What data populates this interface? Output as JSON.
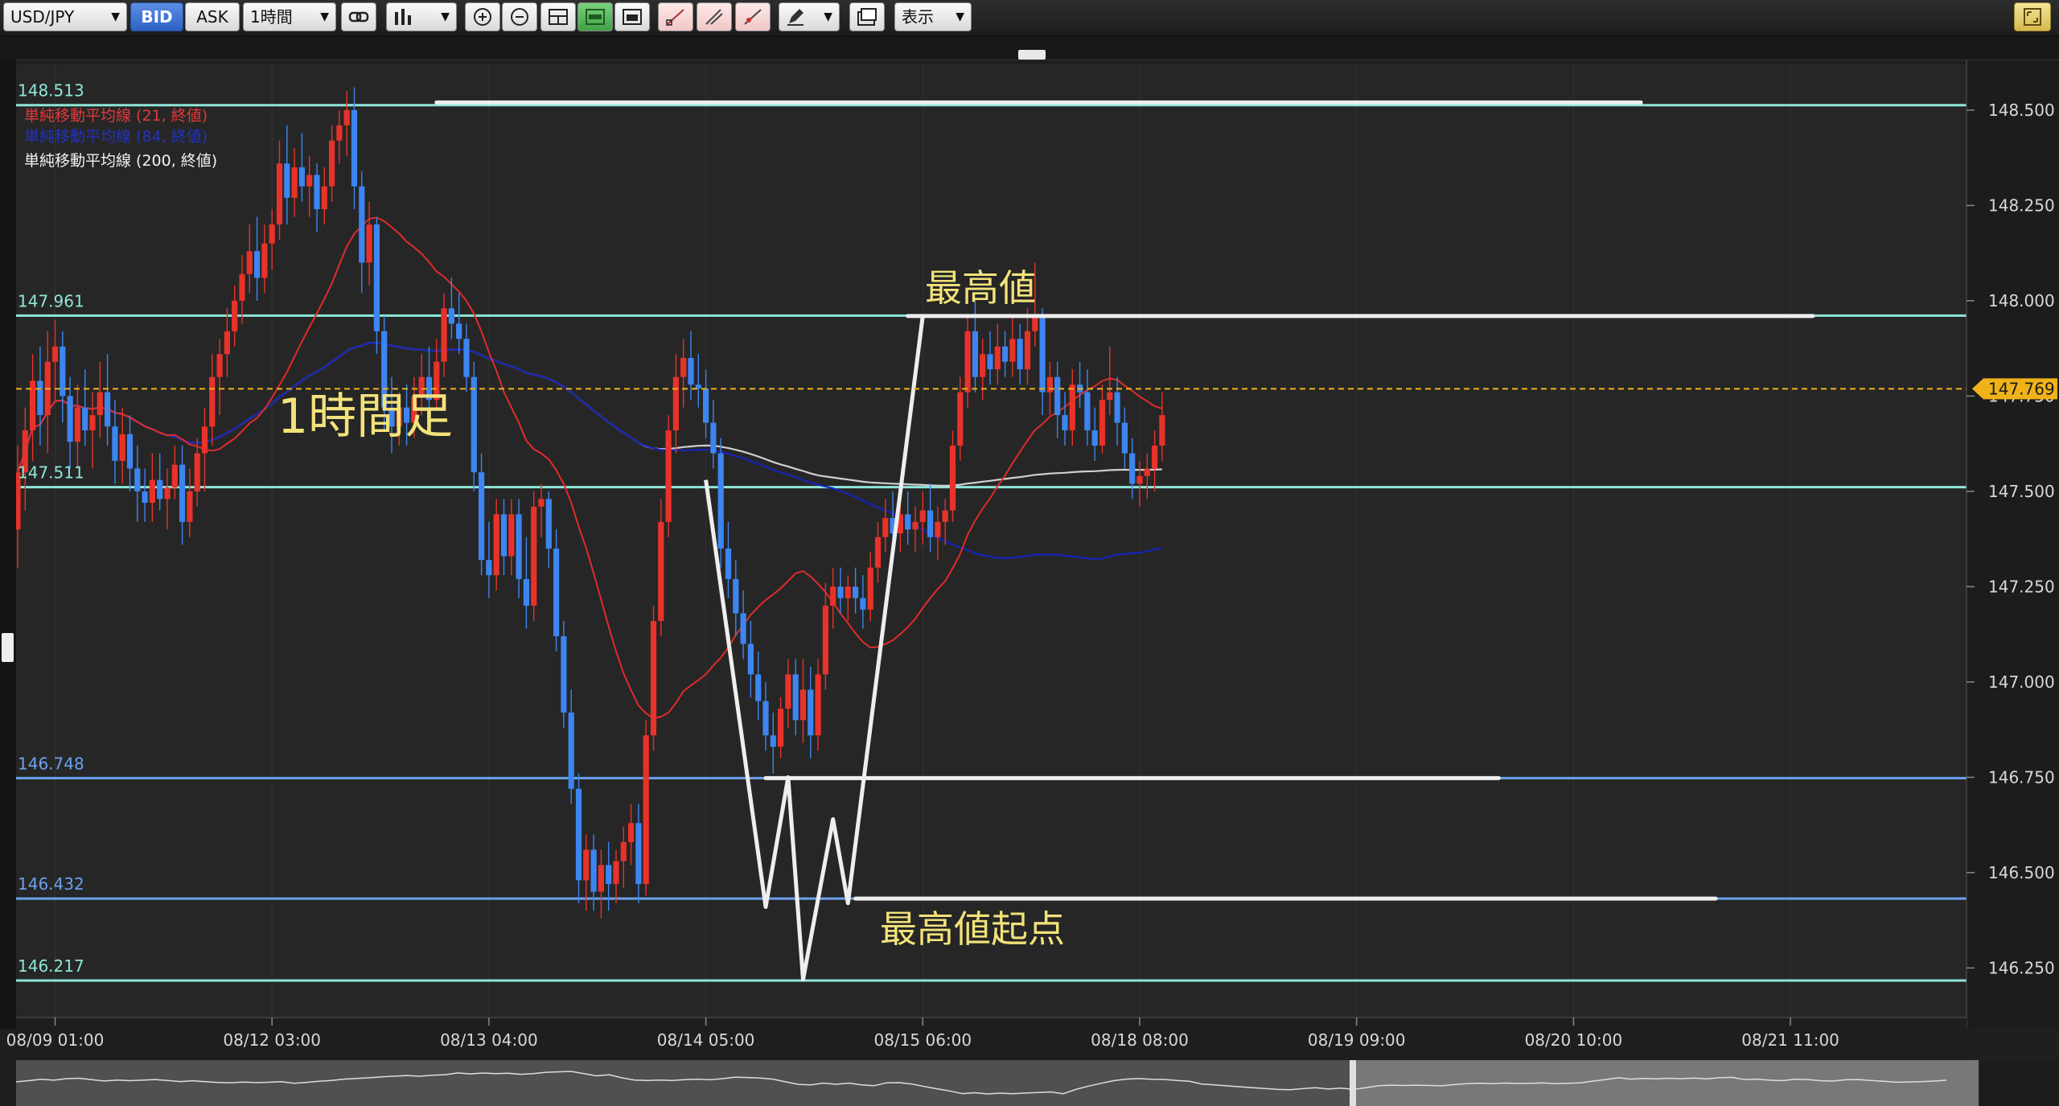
{
  "toolbar": {
    "pair": "USD/JPY",
    "bid": "BID",
    "ask": "ASK",
    "timeframe": "1時間",
    "display": "表示",
    "icons": [
      "chain-link-icon",
      "bar-chart-type-icon",
      "zoom-in-icon",
      "zoom-out-icon",
      "window-tile-icon",
      "toggle-green-icon",
      "window-icon",
      "trendline-icon",
      "channel-icon",
      "fib-icon",
      "pencil-icon",
      "screenshot-icon",
      "maximize-icon"
    ]
  },
  "legend": {
    "sma21": "単純移動平均線 (21, 終値)",
    "sma84": "単純移動平均線 (84, 終値)",
    "sma200": "単純移動平均線 (200, 終値)"
  },
  "annotations": {
    "timeframe_label": "1時間足",
    "high_label": "最高値",
    "high_start_label": "最高値起点"
  },
  "level_labels": [
    "148.513",
    "147.961",
    "147.511",
    "146.748",
    "146.432",
    "146.217"
  ],
  "colors": {
    "background": "#262626",
    "up_candle": "#e8322a",
    "down_candle": "#3d85f0",
    "sma21": "#e02b2b",
    "sma84": "#1622b8",
    "sma200": "#cfcfcf",
    "current_price": "#f0b21a",
    "annotation_text": "#f2e27a",
    "cyan_line": "#8fe6d8",
    "blue_line": "#6aa2ee",
    "drawn_line": "#eeeeee"
  },
  "chart_data": {
    "type": "candlestick",
    "symbol": "USD/JPY",
    "interval": "1時間",
    "price_axis": {
      "ylim": [
        146.12,
        148.62
      ],
      "ticks": [
        "148.500",
        "148.250",
        "148.000",
        "147.750",
        "147.500",
        "147.250",
        "147.000",
        "146.750",
        "146.500",
        "146.250"
      ],
      "current_price": "147.769"
    },
    "time_axis": {
      "ticks": [
        "08/09 01:00",
        "08/12 03:00",
        "08/13 04:00",
        "08/14 05:00",
        "08/15 06:00",
        "08/18 08:00",
        "08/19 09:00",
        "08/20 10:00",
        "08/21 11:00"
      ],
      "tick_bar_index": [
        5,
        34,
        63,
        92,
        121,
        150,
        179,
        208,
        237
      ]
    },
    "horizontal_levels": [
      {
        "label": "148.513",
        "value": 148.513,
        "style": "cyan"
      },
      {
        "label": "147.961",
        "value": 147.961,
        "style": "cyan"
      },
      {
        "label": "147.511",
        "value": 147.511,
        "style": "cyan"
      },
      {
        "label": "146.748",
        "value": 146.748,
        "style": "blue"
      },
      {
        "label": "146.432",
        "value": 146.432,
        "style": "blue"
      },
      {
        "label": "146.217",
        "value": 146.217,
        "style": "cyan"
      }
    ],
    "drawn_horizontal_lines": [
      {
        "price": 148.52,
        "from_bar": 56,
        "to_bar": 217
      },
      {
        "price": 147.96,
        "from_bar": 119,
        "to_bar": 240
      },
      {
        "price": 146.748,
        "from_bar": 100,
        "to_bar": 198
      },
      {
        "price": 146.432,
        "from_bar": 112,
        "to_bar": 227
      }
    ],
    "drawn_zigzag": [
      [
        92,
        147.53
      ],
      [
        100,
        146.41
      ],
      [
        103,
        146.75
      ],
      [
        105,
        146.22
      ],
      [
        109,
        146.64
      ],
      [
        111,
        146.42
      ],
      [
        121,
        147.96
      ]
    ],
    "ohlc": [
      [
        147.4,
        147.62,
        147.3,
        147.55
      ],
      [
        147.55,
        147.72,
        147.45,
        147.66
      ],
      [
        147.66,
        147.86,
        147.58,
        147.79
      ],
      [
        147.79,
        147.88,
        147.62,
        147.7
      ],
      [
        147.7,
        147.92,
        147.6,
        147.84
      ],
      [
        147.84,
        147.95,
        147.74,
        147.88
      ],
      [
        147.88,
        147.92,
        147.68,
        147.75
      ],
      [
        147.75,
        147.8,
        147.56,
        147.63
      ],
      [
        147.63,
        147.78,
        147.56,
        147.72
      ],
      [
        147.72,
        147.82,
        147.62,
        147.66
      ],
      [
        147.66,
        147.76,
        147.56,
        147.7
      ],
      [
        147.7,
        147.84,
        147.64,
        147.76
      ],
      [
        147.76,
        147.86,
        147.62,
        147.67
      ],
      [
        147.67,
        147.74,
        147.52,
        147.58
      ],
      [
        147.58,
        147.72,
        147.52,
        147.65
      ],
      [
        147.65,
        147.7,
        147.5,
        147.56
      ],
      [
        147.56,
        147.62,
        147.42,
        147.5
      ],
      [
        147.5,
        147.56,
        147.42,
        147.47
      ],
      [
        147.47,
        147.6,
        147.42,
        147.53
      ],
      [
        147.53,
        147.6,
        147.45,
        147.48
      ],
      [
        147.48,
        147.56,
        147.4,
        147.51
      ],
      [
        147.51,
        147.62,
        147.48,
        147.57
      ],
      [
        147.57,
        147.62,
        147.36,
        147.42
      ],
      [
        147.42,
        147.56,
        147.38,
        147.5
      ],
      [
        147.5,
        147.64,
        147.46,
        147.6
      ],
      [
        147.6,
        147.72,
        147.5,
        147.67
      ],
      [
        147.67,
        147.86,
        147.62,
        147.8
      ],
      [
        147.8,
        147.9,
        147.7,
        147.86
      ],
      [
        147.86,
        147.98,
        147.8,
        147.92
      ],
      [
        147.92,
        148.04,
        147.88,
        148.0
      ],
      [
        148.0,
        148.12,
        147.94,
        148.07
      ],
      [
        148.07,
        148.2,
        148.02,
        148.13
      ],
      [
        148.13,
        148.22,
        148.0,
        148.06
      ],
      [
        148.06,
        148.2,
        148.02,
        148.15
      ],
      [
        148.15,
        148.24,
        148.08,
        148.2
      ],
      [
        148.2,
        148.42,
        148.16,
        148.36
      ],
      [
        148.36,
        148.46,
        148.2,
        148.27
      ],
      [
        148.27,
        148.4,
        148.22,
        148.35
      ],
      [
        148.35,
        148.44,
        148.26,
        148.3
      ],
      [
        148.3,
        148.38,
        148.22,
        148.33
      ],
      [
        148.33,
        148.36,
        148.18,
        148.24
      ],
      [
        148.24,
        148.35,
        148.2,
        148.3
      ],
      [
        148.3,
        148.46,
        148.26,
        148.42
      ],
      [
        148.42,
        148.5,
        148.36,
        148.46
      ],
      [
        148.46,
        148.55,
        148.38,
        148.5
      ],
      [
        148.5,
        148.56,
        148.24,
        148.3
      ],
      [
        148.3,
        148.34,
        148.02,
        148.1
      ],
      [
        148.1,
        148.26,
        148.04,
        148.2
      ],
      [
        148.2,
        148.22,
        147.86,
        147.92
      ],
      [
        147.92,
        147.96,
        147.66,
        147.72
      ],
      [
        147.72,
        147.8,
        147.6,
        147.67
      ],
      [
        147.67,
        147.76,
        147.62,
        147.72
      ],
      [
        147.72,
        147.78,
        147.62,
        147.68
      ],
      [
        147.68,
        147.8,
        147.64,
        147.75
      ],
      [
        147.75,
        147.86,
        147.7,
        147.8
      ],
      [
        147.8,
        147.88,
        147.7,
        147.74
      ],
      [
        147.74,
        147.9,
        147.72,
        147.84
      ],
      [
        147.84,
        148.02,
        147.8,
        147.98
      ],
      [
        147.98,
        148.06,
        147.9,
        147.94
      ],
      [
        147.94,
        148.02,
        147.86,
        147.9
      ],
      [
        147.9,
        147.94,
        147.76,
        147.8
      ],
      [
        147.8,
        147.84,
        147.5,
        147.55
      ],
      [
        147.55,
        147.6,
        147.28,
        147.32
      ],
      [
        147.32,
        147.42,
        147.22,
        147.28
      ],
      [
        147.28,
        147.48,
        147.24,
        147.44
      ],
      [
        147.44,
        147.48,
        147.28,
        147.33
      ],
      [
        147.33,
        147.48,
        147.28,
        147.44
      ],
      [
        147.44,
        147.48,
        147.22,
        147.27
      ],
      [
        147.27,
        147.38,
        147.14,
        147.2
      ],
      [
        147.2,
        147.5,
        147.16,
        147.46
      ],
      [
        147.46,
        147.52,
        147.38,
        147.48
      ],
      [
        147.48,
        147.5,
        147.3,
        147.35
      ],
      [
        147.35,
        147.4,
        147.08,
        147.12
      ],
      [
        147.12,
        147.16,
        146.88,
        146.92
      ],
      [
        146.92,
        146.98,
        146.68,
        146.72
      ],
      [
        146.72,
        146.76,
        146.42,
        146.48
      ],
      [
        146.48,
        146.6,
        146.4,
        146.56
      ],
      [
        146.56,
        146.6,
        146.4,
        146.45
      ],
      [
        146.45,
        146.56,
        146.38,
        146.52
      ],
      [
        146.52,
        146.58,
        146.4,
        146.47
      ],
      [
        146.47,
        146.56,
        146.42,
        146.53
      ],
      [
        146.53,
        146.62,
        146.46,
        146.58
      ],
      [
        146.58,
        146.68,
        146.52,
        146.63
      ],
      [
        146.63,
        146.68,
        146.42,
        146.47
      ],
      [
        146.47,
        146.9,
        146.44,
        146.86
      ],
      [
        146.86,
        147.2,
        146.82,
        147.16
      ],
      [
        147.16,
        147.48,
        147.12,
        147.42
      ],
      [
        147.42,
        147.7,
        147.38,
        147.66
      ],
      [
        147.66,
        147.86,
        147.6,
        147.8
      ],
      [
        147.8,
        147.9,
        147.72,
        147.85
      ],
      [
        147.85,
        147.92,
        147.74,
        147.78
      ],
      [
        147.78,
        147.86,
        147.72,
        147.77
      ],
      [
        147.77,
        147.82,
        147.64,
        147.68
      ],
      [
        147.68,
        147.74,
        147.56,
        147.6
      ],
      [
        147.6,
        147.64,
        147.3,
        147.35
      ],
      [
        147.35,
        147.42,
        147.22,
        147.27
      ],
      [
        147.27,
        147.32,
        147.12,
        147.18
      ],
      [
        147.18,
        147.24,
        147.06,
        147.1
      ],
      [
        147.1,
        147.16,
        146.96,
        147.02
      ],
      [
        147.02,
        147.08,
        146.9,
        146.95
      ],
      [
        146.95,
        147.0,
        146.82,
        146.86
      ],
      [
        146.86,
        146.92,
        146.76,
        146.83
      ],
      [
        146.83,
        146.96,
        146.8,
        146.93
      ],
      [
        146.93,
        147.06,
        146.88,
        147.02
      ],
      [
        147.02,
        147.06,
        146.86,
        146.9
      ],
      [
        146.9,
        147.06,
        146.84,
        146.98
      ],
      [
        146.98,
        147.04,
        146.8,
        146.86
      ],
      [
        146.86,
        147.06,
        146.82,
        147.02
      ],
      [
        147.02,
        147.26,
        146.98,
        147.2
      ],
      [
        147.2,
        147.3,
        147.14,
        147.25
      ],
      [
        147.25,
        147.3,
        147.18,
        147.22
      ],
      [
        147.22,
        147.28,
        147.16,
        147.25
      ],
      [
        147.25,
        147.3,
        147.18,
        147.22
      ],
      [
        147.22,
        147.28,
        147.14,
        147.19
      ],
      [
        147.19,
        147.34,
        147.16,
        147.3
      ],
      [
        147.3,
        147.42,
        147.26,
        147.38
      ],
      [
        147.38,
        147.48,
        147.34,
        147.43
      ],
      [
        147.43,
        147.5,
        147.36,
        147.39
      ],
      [
        147.39,
        147.48,
        147.34,
        147.44
      ],
      [
        147.44,
        147.5,
        147.36,
        147.4
      ],
      [
        147.4,
        147.46,
        147.34,
        147.42
      ],
      [
        147.42,
        147.5,
        147.36,
        147.45
      ],
      [
        147.45,
        147.52,
        147.34,
        147.38
      ],
      [
        147.38,
        147.46,
        147.32,
        147.42
      ],
      [
        147.42,
        147.48,
        147.36,
        147.45
      ],
      [
        147.45,
        147.66,
        147.42,
        147.62
      ],
      [
        147.62,
        147.8,
        147.58,
        147.76
      ],
      [
        147.76,
        147.96,
        147.72,
        147.92
      ],
      [
        147.92,
        148.0,
        147.76,
        147.8
      ],
      [
        147.8,
        147.9,
        147.74,
        147.86
      ],
      [
        147.86,
        147.92,
        147.78,
        147.82
      ],
      [
        147.82,
        147.94,
        147.78,
        147.88
      ],
      [
        147.88,
        147.92,
        147.8,
        147.84
      ],
      [
        147.84,
        147.96,
        147.8,
        147.9
      ],
      [
        147.9,
        147.94,
        147.78,
        147.82
      ],
      [
        147.82,
        147.98,
        147.78,
        147.92
      ],
      [
        147.92,
        148.1,
        147.88,
        147.96
      ],
      [
        147.96,
        147.98,
        147.7,
        147.76
      ],
      [
        147.76,
        147.84,
        147.7,
        147.8
      ],
      [
        147.8,
        147.84,
        147.64,
        147.7
      ],
      [
        147.7,
        147.76,
        147.62,
        147.66
      ],
      [
        147.66,
        147.82,
        147.62,
        147.78
      ],
      [
        147.78,
        147.84,
        147.72,
        147.76
      ],
      [
        147.76,
        147.82,
        147.62,
        147.66
      ],
      [
        147.66,
        147.72,
        147.58,
        147.62
      ],
      [
        147.62,
        147.78,
        147.6,
        147.74
      ],
      [
        147.74,
        147.88,
        147.7,
        147.76
      ],
      [
        147.76,
        147.8,
        147.62,
        147.68
      ],
      [
        147.68,
        147.72,
        147.56,
        147.6
      ],
      [
        147.6,
        147.64,
        147.48,
        147.52
      ],
      [
        147.52,
        147.58,
        147.46,
        147.54
      ],
      [
        147.54,
        147.6,
        147.48,
        147.56
      ],
      [
        147.56,
        147.66,
        147.5,
        147.62
      ],
      [
        147.62,
        147.76,
        147.58,
        147.7
      ]
    ]
  }
}
